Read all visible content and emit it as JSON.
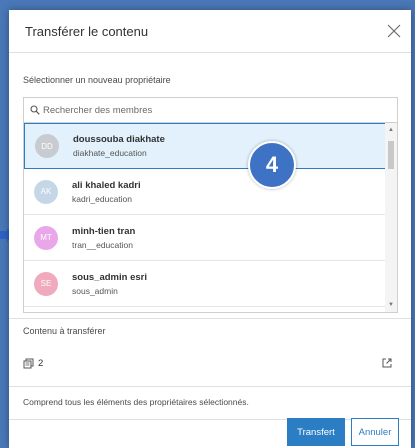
{
  "dialog": {
    "title": "Transférer le contenu",
    "new_owner_label": "Sélectionner un nouveau propriétaire",
    "search_placeholder": "Rechercher des membres",
    "members": [
      {
        "initials": "DD",
        "name": "doussouba diakhate",
        "username": "diakhate_education",
        "color": "#c8cbd0",
        "selected": true
      },
      {
        "initials": "AK",
        "name": "ali khaled kadri",
        "username": "kadri_education",
        "color": "#c5d7e6",
        "selected": false
      },
      {
        "initials": "MT",
        "name": "minh-tien tran",
        "username": "tran__education",
        "color": "#e9a7ea",
        "selected": false
      },
      {
        "initials": "SE",
        "name": "sous_admin esri",
        "username": "sous_admin",
        "color": "#f0a9bd",
        "selected": false
      }
    ],
    "step_badge": "4",
    "content_label": "Contenu à transférer",
    "content_count": "2",
    "content_note": "Comprend tous les éléments des propriétaires sélectionnés.",
    "transfer_button": "Transfert",
    "cancel_button": "Annuler"
  },
  "colors": {
    "accent": "#2b7ec4",
    "selected_bg": "#e2f1fb",
    "badge": "#3d72c4"
  }
}
